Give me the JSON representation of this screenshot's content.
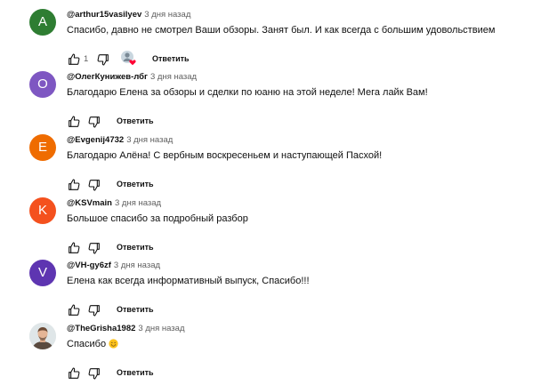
{
  "comments": [
    {
      "avatar_letter": "A",
      "avatar_color": "#2e7d32",
      "author": "@arthur15vasilyev",
      "time": "3 дня назад",
      "text": "Спасибо, давно не смотрел Ваши обзоры. Занят был. И как всегда с большим удовольствием",
      "likes": "1",
      "reply_label": "Ответить",
      "has_creator_heart": true
    },
    {
      "avatar_letter": "О",
      "avatar_color": "#7e57c2",
      "author": "@ОлегКунижев-лбг",
      "time": "3 дня назад",
      "text": "Благодарю Елена за обзоры и сделки по юаню на этой неделе! Мега лайк Вам!",
      "reply_label": "Ответить"
    },
    {
      "avatar_letter": "E",
      "avatar_color": "#ef6c00",
      "author": "@Evgenij4732",
      "time": "3 дня назад",
      "text": "Благодарю Алёна! С вербным воскресеньем и наступающей Пасхой!",
      "reply_label": "Ответить"
    },
    {
      "avatar_letter": "K",
      "avatar_color": "#f4511e",
      "author": "@KSVmain",
      "time": "3 дня назад",
      "text": "Большое спасибо за подробный разбор",
      "reply_label": "Ответить"
    },
    {
      "avatar_letter": "V",
      "avatar_color": "#5e35b1",
      "author": "@VH-gy6zf",
      "time": "3 дня назад",
      "text": "Елена как всегда информативный выпуск, Спасибо!!!",
      "reply_label": "Ответить"
    },
    {
      "avatar_letter": "",
      "avatar_color": "#dfe6e8",
      "author": "@TheGrisha1982",
      "time": "3 дня назад",
      "text": "Спасибо",
      "has_emoji": true,
      "reply_label": "Ответить"
    }
  ]
}
